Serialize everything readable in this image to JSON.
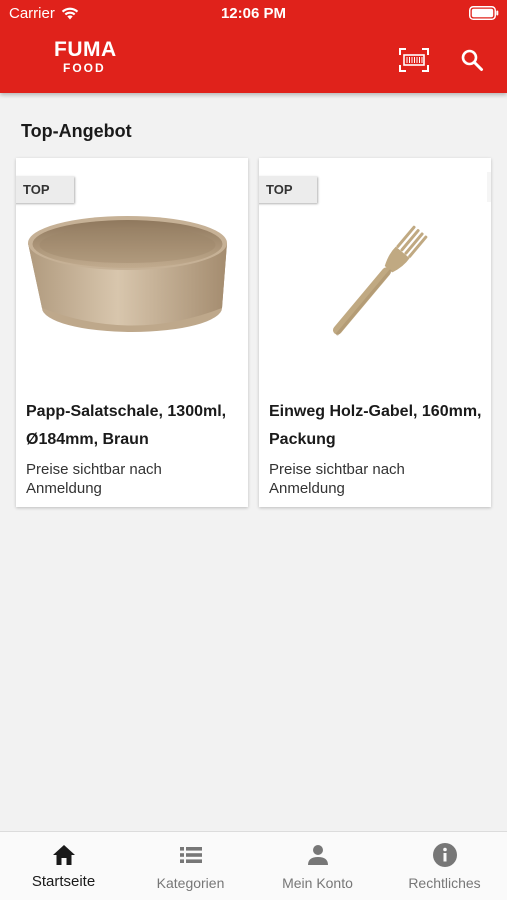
{
  "status_bar": {
    "carrier": "Carrier",
    "time": "12:06 PM"
  },
  "header": {
    "logo_main": "FUMA",
    "logo_sub": "FOOD",
    "accent_color": "#e0221b",
    "actions": [
      "barcode-scan-icon",
      "search-icon"
    ]
  },
  "section": {
    "title": "Top-Angebot"
  },
  "products": [
    {
      "badge": "TOP",
      "title": "Papp-Salatschale, 1300ml, Ø184mm, Braun",
      "price_note": "Preise sichtbar nach Anmeldung",
      "image": "kraft-salad-bowl"
    },
    {
      "badge": "TOP",
      "title": "Einweg Holz-Gabel, 160mm, Packung",
      "price_note": "Preise sichtbar nach Anmeldung",
      "image": "wooden-fork"
    }
  ],
  "tabs": [
    {
      "label": "Startseite",
      "icon": "home-icon",
      "active": true
    },
    {
      "label": "Kategorien",
      "icon": "list-icon",
      "active": false
    },
    {
      "label": "Mein Konto",
      "icon": "person-icon",
      "active": false
    },
    {
      "label": "Rechtliches",
      "icon": "info-icon",
      "active": false
    }
  ]
}
